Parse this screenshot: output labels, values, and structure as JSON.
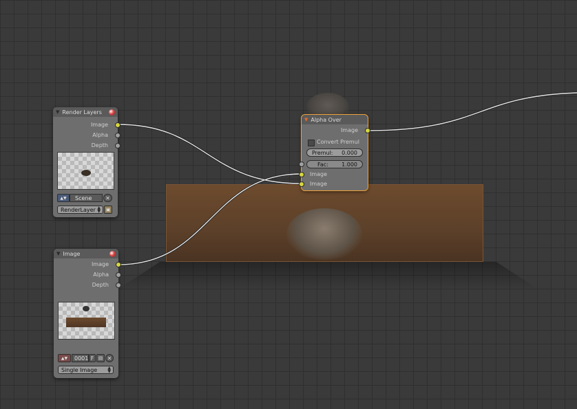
{
  "nodes": {
    "render_layers": {
      "title": "Render Layers",
      "outputs": [
        "Image",
        "Alpha",
        "Depth"
      ],
      "scene_label": "Scene",
      "layer_label": "RenderLayer"
    },
    "alpha_over": {
      "title": "Alpha Over",
      "output": "Image",
      "convert_premul_label": "Convert Premul",
      "premul": {
        "label": "Premul:",
        "value": "0.000"
      },
      "fac": {
        "label": "Fac:",
        "value": "1.000"
      },
      "inputs": [
        "Image",
        "Image"
      ]
    },
    "image": {
      "title": "Image",
      "outputs": [
        "Image",
        "Alpha",
        "Depth"
      ],
      "frame": "0001",
      "frame_flag": "F",
      "source": "Single Image"
    }
  },
  "colors": {
    "socket_image": "#d6d642",
    "socket_value": "#a0a0a0",
    "selected_outline": "#f0a23a",
    "wire": "#e8e8e8"
  }
}
